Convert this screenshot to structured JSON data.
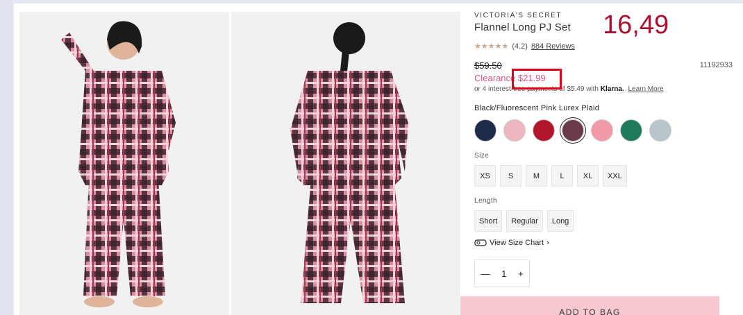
{
  "product": {
    "brand": "VICTORIA'S SECRET",
    "title": "Flannel Long PJ Set",
    "stars": "★★★★★",
    "rating": "(4.2)",
    "reviews": "884 Reviews",
    "was_price": "$59.50",
    "sku": "11192933",
    "clearance_label": "Clearance $21.99",
    "klarna_text": "or 4 interest-free payments of $5.49 with",
    "klarna_brand": "Klarna.",
    "learn_more": "Learn More",
    "color_name": "Black/Fluorescent Pink Lurex Plaid"
  },
  "annotation": {
    "value": "16,49",
    "color": "#a8122f"
  },
  "swatches": [
    {
      "name": "navy-dots",
      "color": "#1e2a4a"
    },
    {
      "name": "pink-stripe",
      "color": "#f0b6bf"
    },
    {
      "name": "red-plaid",
      "color": "#b0172c"
    },
    {
      "name": "black-pink-plaid",
      "color": "#6b3a4a"
    },
    {
      "name": "pink-white-plaid",
      "color": "#f39aa8"
    },
    {
      "name": "green-plaid",
      "color": "#1f7a5a"
    },
    {
      "name": "grey-plaid",
      "color": "#b9c4c9"
    }
  ],
  "size": {
    "label": "Size",
    "options": [
      "XS",
      "S",
      "M",
      "L",
      "XL",
      "XXL"
    ]
  },
  "length": {
    "label": "Length",
    "options": [
      "Short",
      "Regular",
      "Long"
    ]
  },
  "size_chart": "View Size Chart",
  "quantity": {
    "minus": "—",
    "value": "1",
    "plus": "+"
  },
  "add_to_bag": "ADD TO BAG"
}
